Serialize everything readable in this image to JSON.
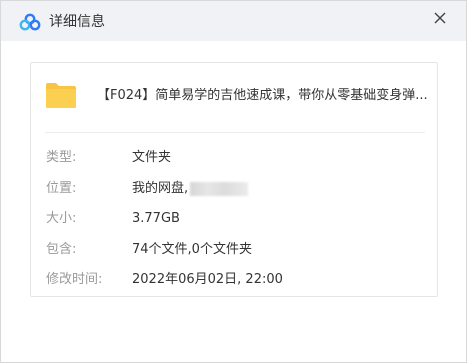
{
  "window": {
    "title": "详细信息",
    "app_icon": "cloud-icon",
    "close_icon": "close-icon"
  },
  "file": {
    "icon": "folder-icon",
    "name": "【F024】简单易学的吉他速成课，带你从零基础变身弹..."
  },
  "details": [
    {
      "label": "类型:",
      "value": "文件夹"
    },
    {
      "label": "位置:",
      "value": "我的网盘,"
    },
    {
      "label": "大小:",
      "value": "3.77GB"
    },
    {
      "label": "包含:",
      "value": "74个文件,0个文件夹"
    },
    {
      "label": "修改时间:",
      "value": "2022年06月02日, 22:00"
    }
  ],
  "colors": {
    "titlebar_bg": "#f1f2f5",
    "folder": "#f7c445",
    "brand_blue": "#2f7bf5",
    "label_gray": "#9a9a9a"
  }
}
